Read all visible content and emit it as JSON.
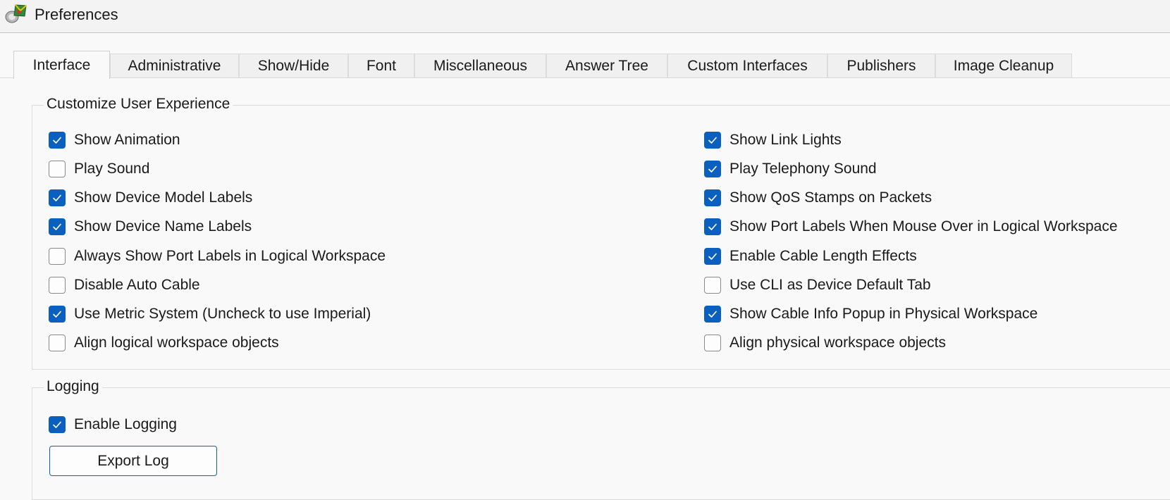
{
  "window": {
    "title": "Preferences"
  },
  "tabs": [
    {
      "label": "Interface",
      "active": true
    },
    {
      "label": "Administrative"
    },
    {
      "label": "Show/Hide"
    },
    {
      "label": "Font"
    },
    {
      "label": "Miscellaneous"
    },
    {
      "label": "Answer Tree"
    },
    {
      "label": "Custom Interfaces"
    },
    {
      "label": "Publishers"
    },
    {
      "label": "Image Cleanup"
    }
  ],
  "customize": {
    "title": "Customize User Experience",
    "left": [
      {
        "label": "Show Animation",
        "checked": true
      },
      {
        "label": "Play Sound",
        "checked": false
      },
      {
        "label": "Show Device Model Labels",
        "checked": true
      },
      {
        "label": "Show Device Name Labels",
        "checked": true
      },
      {
        "label": "Always Show Port Labels in Logical Workspace",
        "checked": false
      },
      {
        "label": "Disable Auto Cable",
        "checked": false
      },
      {
        "label": "Use Metric System (Uncheck to use Imperial)",
        "checked": true
      },
      {
        "label": "Align logical workspace objects",
        "checked": false
      }
    ],
    "right": [
      {
        "label": "Show Link Lights",
        "checked": true
      },
      {
        "label": "Play Telephony Sound",
        "checked": true
      },
      {
        "label": "Show QoS Stamps on Packets",
        "checked": true
      },
      {
        "label": "Show Port Labels When Mouse Over in Logical Workspace",
        "checked": true
      },
      {
        "label": "Enable Cable Length Effects",
        "checked": true
      },
      {
        "label": "Use CLI as Device Default Tab",
        "checked": false
      },
      {
        "label": "Show Cable Info Popup in Physical Workspace",
        "checked": true
      },
      {
        "label": "Align physical workspace objects",
        "checked": false
      }
    ]
  },
  "logging": {
    "title": "Logging",
    "enable": {
      "label": "Enable Logging",
      "checked": true
    },
    "export_label": "Export Log"
  },
  "colors": {
    "accent": "#0a5fbf",
    "background": "#f9f9f9"
  }
}
